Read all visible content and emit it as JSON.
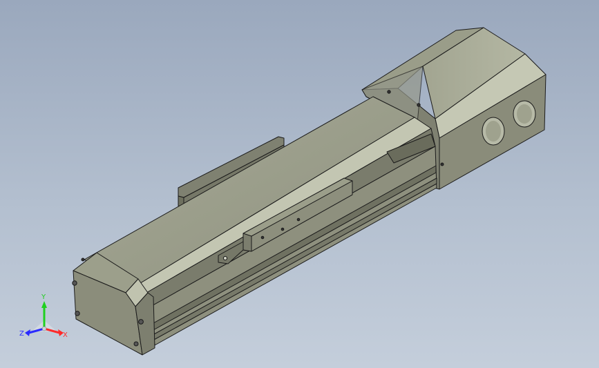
{
  "triad": {
    "x_label": "X",
    "y_label": "Y",
    "z_label": "Z",
    "x_color": "#ff2a2a",
    "y_color": "#1fd01f",
    "z_color": "#2a2aff"
  },
  "model": {
    "name": "linear-actuator-module",
    "body_color": "#8c8e7c",
    "edge_color": "#1a1a1a"
  }
}
